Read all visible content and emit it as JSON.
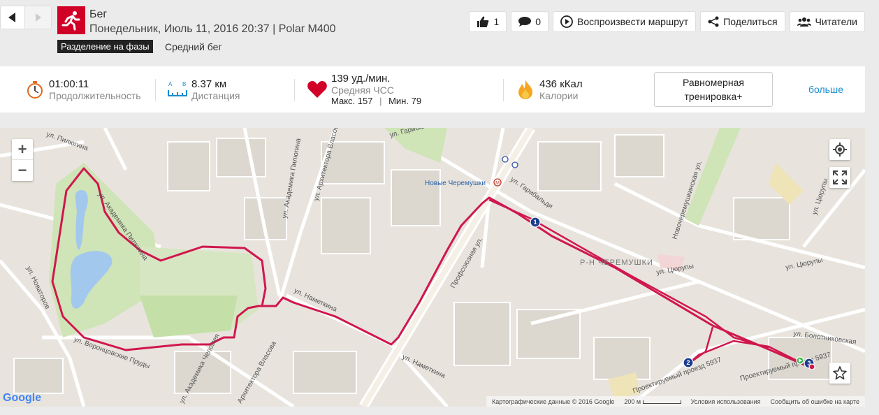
{
  "header": {
    "title": "Бег",
    "subtitle": "Понедельник, Июль 11, 2016 20:37 | Polar M400",
    "phase_badge": "Разделение на фазы",
    "phase_label": "Средний бег",
    "sport_color": "#d10027"
  },
  "actions": {
    "like_count": "1",
    "comment_count": "0",
    "replay_label": "Воспроизвести маршрут",
    "share_label": "Поделиться",
    "followers_label": "Читатели"
  },
  "stats": {
    "duration": {
      "value": "01:00:11",
      "label": "Продолжительность"
    },
    "distance": {
      "value": "8.37 км",
      "label": "Дистанция",
      "icon_a": "A",
      "icon_b": "B"
    },
    "heart_rate": {
      "value": "139 уд./мин.",
      "label": "Средняя ЧСС",
      "max": "Макс. 157",
      "min": "Мин. 79"
    },
    "calories": {
      "value": "436 кКал",
      "label": "Калории"
    },
    "training_benefit": "Равномерная тренировка+",
    "more_link": "больше"
  },
  "map": {
    "zoom_in": "+",
    "zoom_out": "−",
    "google_logo": "Google",
    "attribution": "Картографические данные © 2016 Google",
    "scale_label": "200 м",
    "terms": "Условия использования",
    "report_error": "Сообщить об ошибке на карте",
    "route_color": "#d0174d",
    "laps": [
      "1",
      "2",
      "3"
    ],
    "labels": {
      "novye_cheremushki": "Новые Черемушки",
      "metro_symbol": "M",
      "r_n_cheremushki": "Р-Н ЧЕРЕМУШКИ",
      "ul_garibaldi_1": "ул. Гарибальди",
      "ul_garibaldi_2": "ул. Гарибальди",
      "profsoyuznaya": "Профсоюзная ул.",
      "ul_piliugina_1": "ул. Пилюгина",
      "ul_akademika_piliugina": "ул. Академика Пилюгина",
      "ul_akademika_piliugina_2": "ул. Академика Пилюгина",
      "ul_arkhitektora_vlasova": "ул. Архитектора Власова",
      "ul_novatorov": "ул. Новаторов",
      "ul_vorontsovskie_prudy": "ул. Воронцовские Пруды",
      "ul_akademika_chelomeya": "ул. Академика Челомея",
      "arkhitektora_vlasova_2": "Архитектора Власова",
      "ul_nametkina_1": "ул. Наметкина",
      "ul_nametkina_2": "ул. Наметкина",
      "ul_tsyurupy_1": "ул. Цюрупы",
      "ul_tsyurupy_2": "ул. Цюрупы",
      "ul_tsyurupy_3": "ул. Цюрупы",
      "novocheremushkinskaya": "Новочеремушкинская ул.",
      "ul_bolotnikovskaya": "ул. Болотниковская",
      "proektiruemyy_proezd": "Проектируемый проезд 5937",
      "proektiruemyy_proezd_2": "Проектируемый проезд 5937"
    }
  }
}
